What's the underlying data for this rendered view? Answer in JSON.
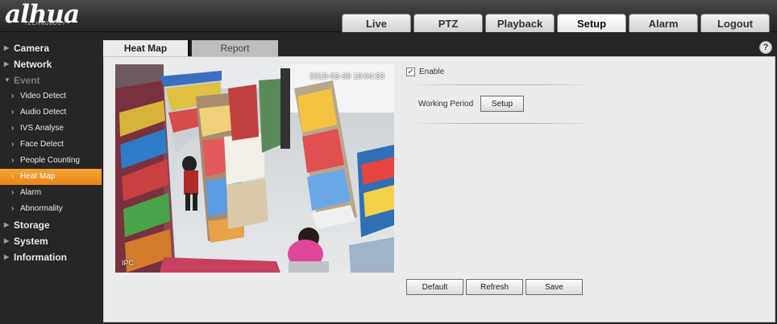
{
  "brand": {
    "logo": "alhua",
    "tagline": "TECHNOLOGY"
  },
  "nav": {
    "tabs": [
      {
        "label": "Live"
      },
      {
        "label": "PTZ"
      },
      {
        "label": "Playback"
      },
      {
        "label": "Setup",
        "active": true
      },
      {
        "label": "Alarm"
      },
      {
        "label": "Logout"
      }
    ]
  },
  "sidebar": {
    "items": [
      {
        "label": "Camera",
        "level": "top"
      },
      {
        "label": "Network",
        "level": "top"
      },
      {
        "label": "Event",
        "level": "top",
        "expanded": true
      },
      {
        "label": "Video Detect",
        "level": "sub"
      },
      {
        "label": "Audio Detect",
        "level": "sub"
      },
      {
        "label": "IVS Analyse",
        "level": "sub"
      },
      {
        "label": "Face Detect",
        "level": "sub"
      },
      {
        "label": "People Counting",
        "level": "sub"
      },
      {
        "label": "Heat Map",
        "level": "sub",
        "active": true
      },
      {
        "label": "Alarm",
        "level": "sub"
      },
      {
        "label": "Abnormality",
        "level": "sub"
      },
      {
        "label": "Storage",
        "level": "top"
      },
      {
        "label": "System",
        "level": "top"
      },
      {
        "label": "Information",
        "level": "top"
      }
    ]
  },
  "content": {
    "tabs": {
      "heatmap": "Heat Map",
      "report": "Report"
    },
    "help": "?",
    "video": {
      "timestamp": "2015-03-30 19:04:53",
      "channel_label": "IPC"
    },
    "enable": {
      "label": "Enable",
      "checked": true,
      "mark": "✓"
    },
    "working_period": {
      "label": "Working Period",
      "button": "Setup"
    },
    "buttons": {
      "default": "Default",
      "refresh": "Refresh",
      "save": "Save"
    }
  },
  "icons": {
    "collapsed": "triangle-right-icon",
    "expanded": "triangle-down-icon",
    "sub": "chevron-right-icon",
    "help": "help-icon",
    "check": "checkmark-icon"
  },
  "colors": {
    "active_item": "#f09a2a",
    "header_bg": "#303030",
    "panel_bg": "#ebebeb",
    "sidebar_bg": "#262626"
  }
}
